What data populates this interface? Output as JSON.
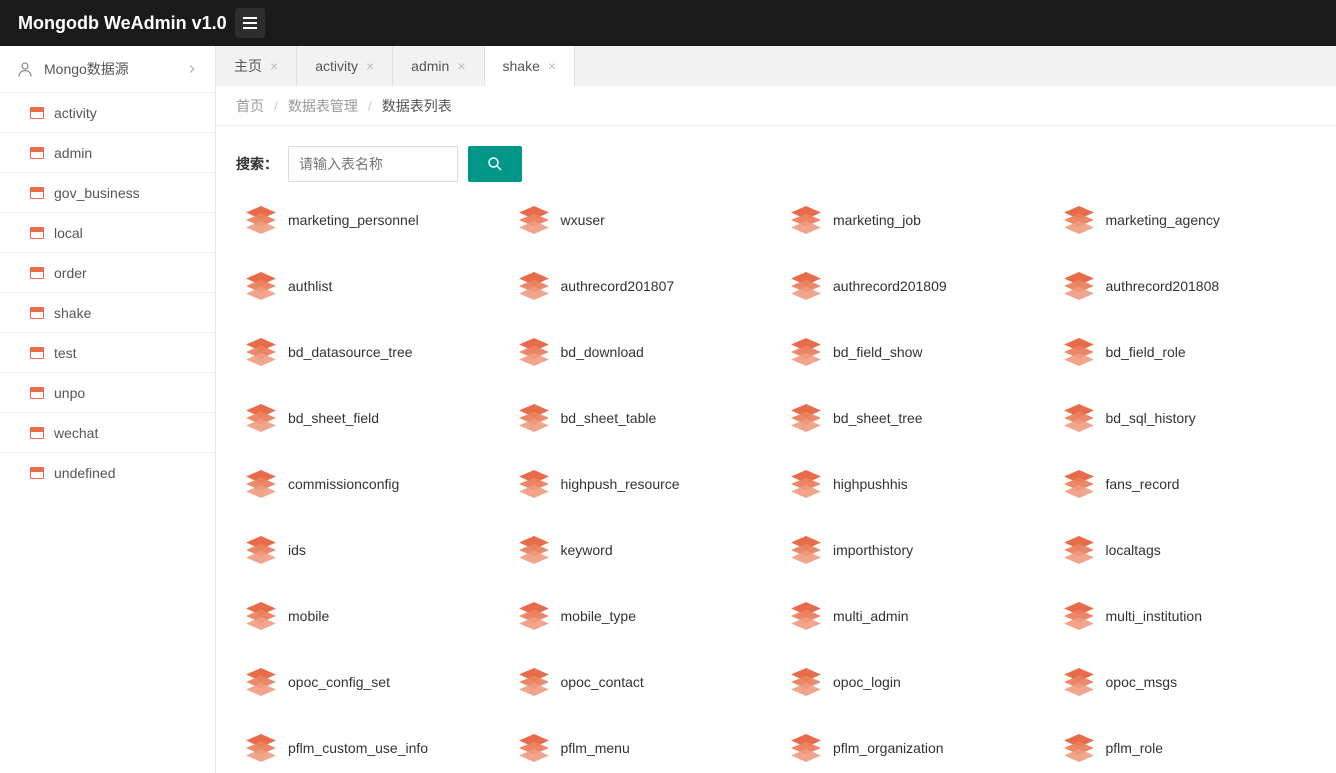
{
  "brand": "Mongodb WeAdmin v1.0",
  "sidebar": {
    "header": "Mongo数据源",
    "items": [
      {
        "label": "activity"
      },
      {
        "label": "admin"
      },
      {
        "label": "gov_business"
      },
      {
        "label": "local"
      },
      {
        "label": "order"
      },
      {
        "label": "shake"
      },
      {
        "label": "test"
      },
      {
        "label": "unpo"
      },
      {
        "label": "wechat"
      },
      {
        "label": "undefined"
      }
    ]
  },
  "tabs": [
    {
      "label": "主页",
      "closable": true,
      "active": false
    },
    {
      "label": "activity",
      "closable": true,
      "active": false
    },
    {
      "label": "admin",
      "closable": true,
      "active": false
    },
    {
      "label": "shake",
      "closable": true,
      "active": true
    }
  ],
  "breadcrumb": {
    "home": "首页",
    "parent": "数据表管理",
    "current": "数据表列表"
  },
  "search": {
    "label": "搜索：",
    "placeholder": "请输入表名称"
  },
  "tables": [
    "marketing_personnel",
    "wxuser",
    "marketing_job",
    "marketing_agency",
    "authlist",
    "authrecord201807",
    "authrecord201809",
    "authrecord201808",
    "bd_datasource_tree",
    "bd_download",
    "bd_field_show",
    "bd_field_role",
    "bd_sheet_field",
    "bd_sheet_table",
    "bd_sheet_tree",
    "bd_sql_history",
    "commissionconfig",
    "highpush_resource",
    "highpushhis",
    "fans_record",
    "ids",
    "keyword",
    "importhistory",
    "localtags",
    "mobile",
    "mobile_type",
    "multi_admin",
    "multi_institution",
    "opoc_config_set",
    "opoc_contact",
    "opoc_login",
    "opoc_msgs",
    "pflm_custom_use_info",
    "pflm_menu",
    "pflm_organization",
    "pflm_role"
  ]
}
